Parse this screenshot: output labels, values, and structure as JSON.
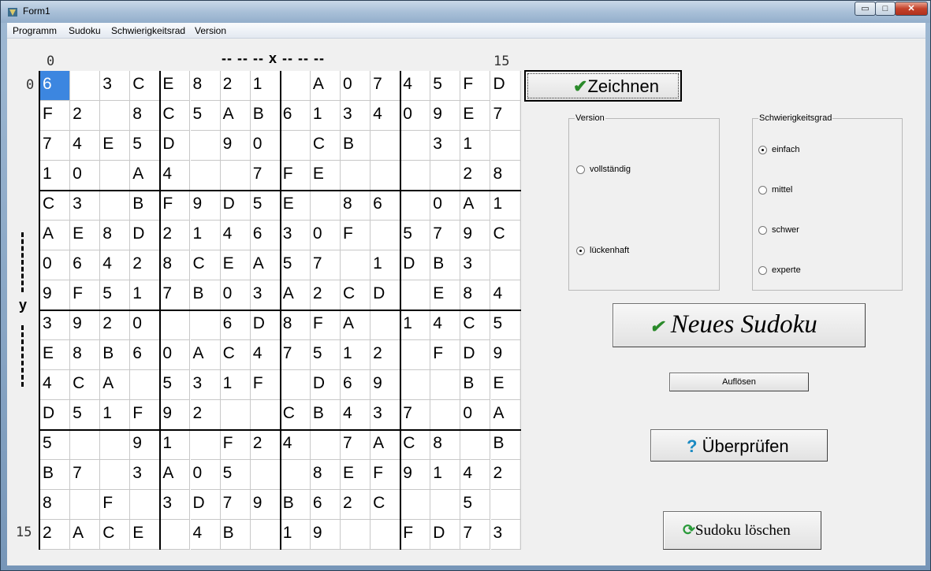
{
  "window": {
    "title": "Form1",
    "minimize": "▭",
    "maximize": "□",
    "close": "✕"
  },
  "menu": [
    "Programm",
    "Sudoku",
    "Schwierigkeitsrad",
    "Version"
  ],
  "axis": {
    "x_start": "0",
    "x_end": "15",
    "x_label": "-- -- -- x -- -- --",
    "y_start": "0",
    "y_end": "15",
    "y_label": "y"
  },
  "grid": [
    [
      "6",
      "",
      "3",
      "C",
      "E",
      "8",
      "2",
      "1",
      "",
      "A",
      "0",
      "7",
      "4",
      "5",
      "F",
      "D"
    ],
    [
      "F",
      "2",
      "",
      "8",
      "C",
      "5",
      "A",
      "B",
      "6",
      "1",
      "3",
      "4",
      "0",
      "9",
      "E",
      "7"
    ],
    [
      "7",
      "4",
      "E",
      "5",
      "D",
      "",
      "9",
      "0",
      "",
      "C",
      "B",
      "",
      "",
      "3",
      "1",
      ""
    ],
    [
      "1",
      "0",
      "",
      "A",
      "4",
      "",
      "",
      "7",
      "F",
      "E",
      "",
      "",
      "",
      "",
      "2",
      "8"
    ],
    [
      "C",
      "3",
      "",
      "B",
      "F",
      "9",
      "D",
      "5",
      "E",
      "",
      "8",
      "6",
      "",
      "0",
      "A",
      "1"
    ],
    [
      "A",
      "E",
      "8",
      "D",
      "2",
      "1",
      "4",
      "6",
      "3",
      "0",
      "F",
      "",
      "5",
      "7",
      "9",
      "C"
    ],
    [
      "0",
      "6",
      "4",
      "2",
      "8",
      "C",
      "E",
      "A",
      "5",
      "7",
      "",
      "1",
      "D",
      "B",
      "3",
      ""
    ],
    [
      "9",
      "F",
      "5",
      "1",
      "7",
      "B",
      "0",
      "3",
      "A",
      "2",
      "C",
      "D",
      "",
      "E",
      "8",
      "4"
    ],
    [
      "3",
      "9",
      "2",
      "0",
      "",
      "",
      "6",
      "D",
      "8",
      "F",
      "A",
      "",
      "1",
      "4",
      "C",
      "5"
    ],
    [
      "E",
      "8",
      "B",
      "6",
      "0",
      "A",
      "C",
      "4",
      "7",
      "5",
      "1",
      "2",
      "",
      "F",
      "D",
      "9"
    ],
    [
      "4",
      "C",
      "A",
      "",
      "5",
      "3",
      "1",
      "F",
      "",
      "D",
      "6",
      "9",
      "",
      "",
      "B",
      "E"
    ],
    [
      "D",
      "5",
      "1",
      "F",
      "9",
      "2",
      "",
      "",
      "C",
      "B",
      "4",
      "3",
      "7",
      "",
      "0",
      "A"
    ],
    [
      "5",
      "",
      "",
      "9",
      "1",
      "",
      "F",
      "2",
      "4",
      "",
      "7",
      "A",
      "C",
      "8",
      "",
      "B"
    ],
    [
      "B",
      "7",
      "",
      "3",
      "A",
      "0",
      "5",
      "",
      "",
      "8",
      "E",
      "F",
      "9",
      "1",
      "4",
      "2"
    ],
    [
      "8",
      "",
      "F",
      "",
      "3",
      "D",
      "7",
      "9",
      "B",
      "6",
      "2",
      "C",
      "",
      "",
      "5",
      ""
    ],
    [
      "2",
      "A",
      "C",
      "E",
      "",
      "4",
      "B",
      "",
      "1",
      "9",
      "",
      "",
      "F",
      "D",
      "7",
      "3"
    ]
  ],
  "selected_cell": {
    "row": 0,
    "col": 0
  },
  "buttons": {
    "zeichnen": "Zeichnen",
    "neues_sudoku": "Neues Sudoku",
    "aufloesen": "Auflösen",
    "ueberpruefen": "Überprüfen",
    "sudoku_loeschen": "Sudoku löschen"
  },
  "version_group": {
    "legend": "Version",
    "options": [
      {
        "label": "vollständig",
        "checked": false
      },
      {
        "label": "lückenhaft",
        "checked": true
      }
    ]
  },
  "level_group": {
    "legend": "Schwierigkeitsgrad",
    "options": [
      {
        "label": "einfach",
        "checked": true
      },
      {
        "label": "mittel",
        "checked": false
      },
      {
        "label": "schwer",
        "checked": false
      },
      {
        "label": "experte",
        "checked": false
      }
    ]
  },
  "icons": {
    "check": "check-icon",
    "help": "question-icon",
    "refresh": "refresh-icon"
  }
}
